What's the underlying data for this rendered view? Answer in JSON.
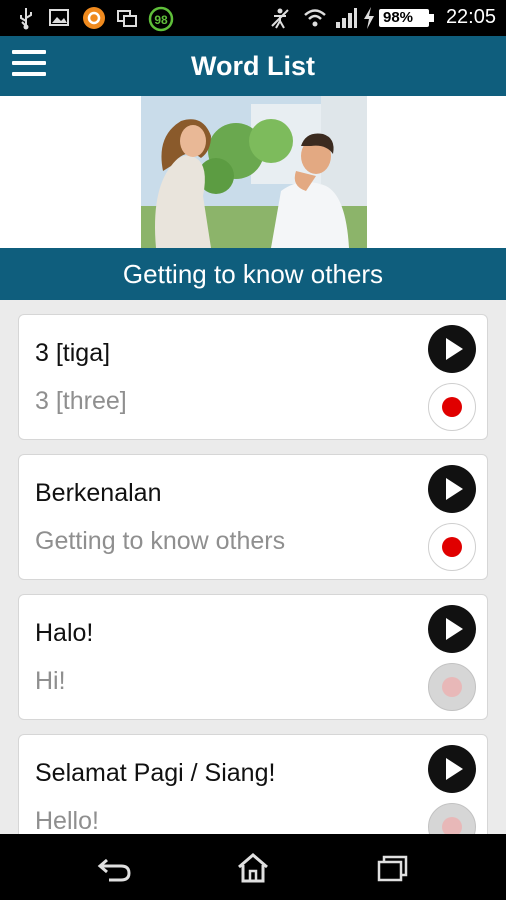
{
  "status_bar": {
    "time": "22:05",
    "battery": "98%",
    "notification_badge": "98",
    "icons": [
      "usb-icon",
      "image-icon",
      "orange-app-icon",
      "multiwindow-icon",
      "badge-icon",
      "accessibility-icon",
      "wifi-icon",
      "signal-icon",
      "charging-icon",
      "battery-icon"
    ]
  },
  "app_bar": {
    "title": "Word List",
    "menu_icon": "hamburger-menu-icon"
  },
  "section": {
    "title": "Getting to know others"
  },
  "words": [
    {
      "word": "3 [tiga]",
      "translation": "3 [three]",
      "record_enabled": true
    },
    {
      "word": "Berkenalan",
      "translation": "Getting to know others",
      "record_enabled": true
    },
    {
      "word": "Halo!",
      "translation": "Hi!",
      "record_enabled": false
    },
    {
      "word": "Selamat Pagi / Siang!",
      "translation": "Hello!",
      "record_enabled": false
    }
  ],
  "nav_bar": {
    "icons": [
      "back-icon",
      "home-icon",
      "recent-apps-icon"
    ]
  },
  "colors": {
    "primary": "#0f5e7d",
    "record": "#e00000",
    "translation_text": "#8f8f8f"
  }
}
